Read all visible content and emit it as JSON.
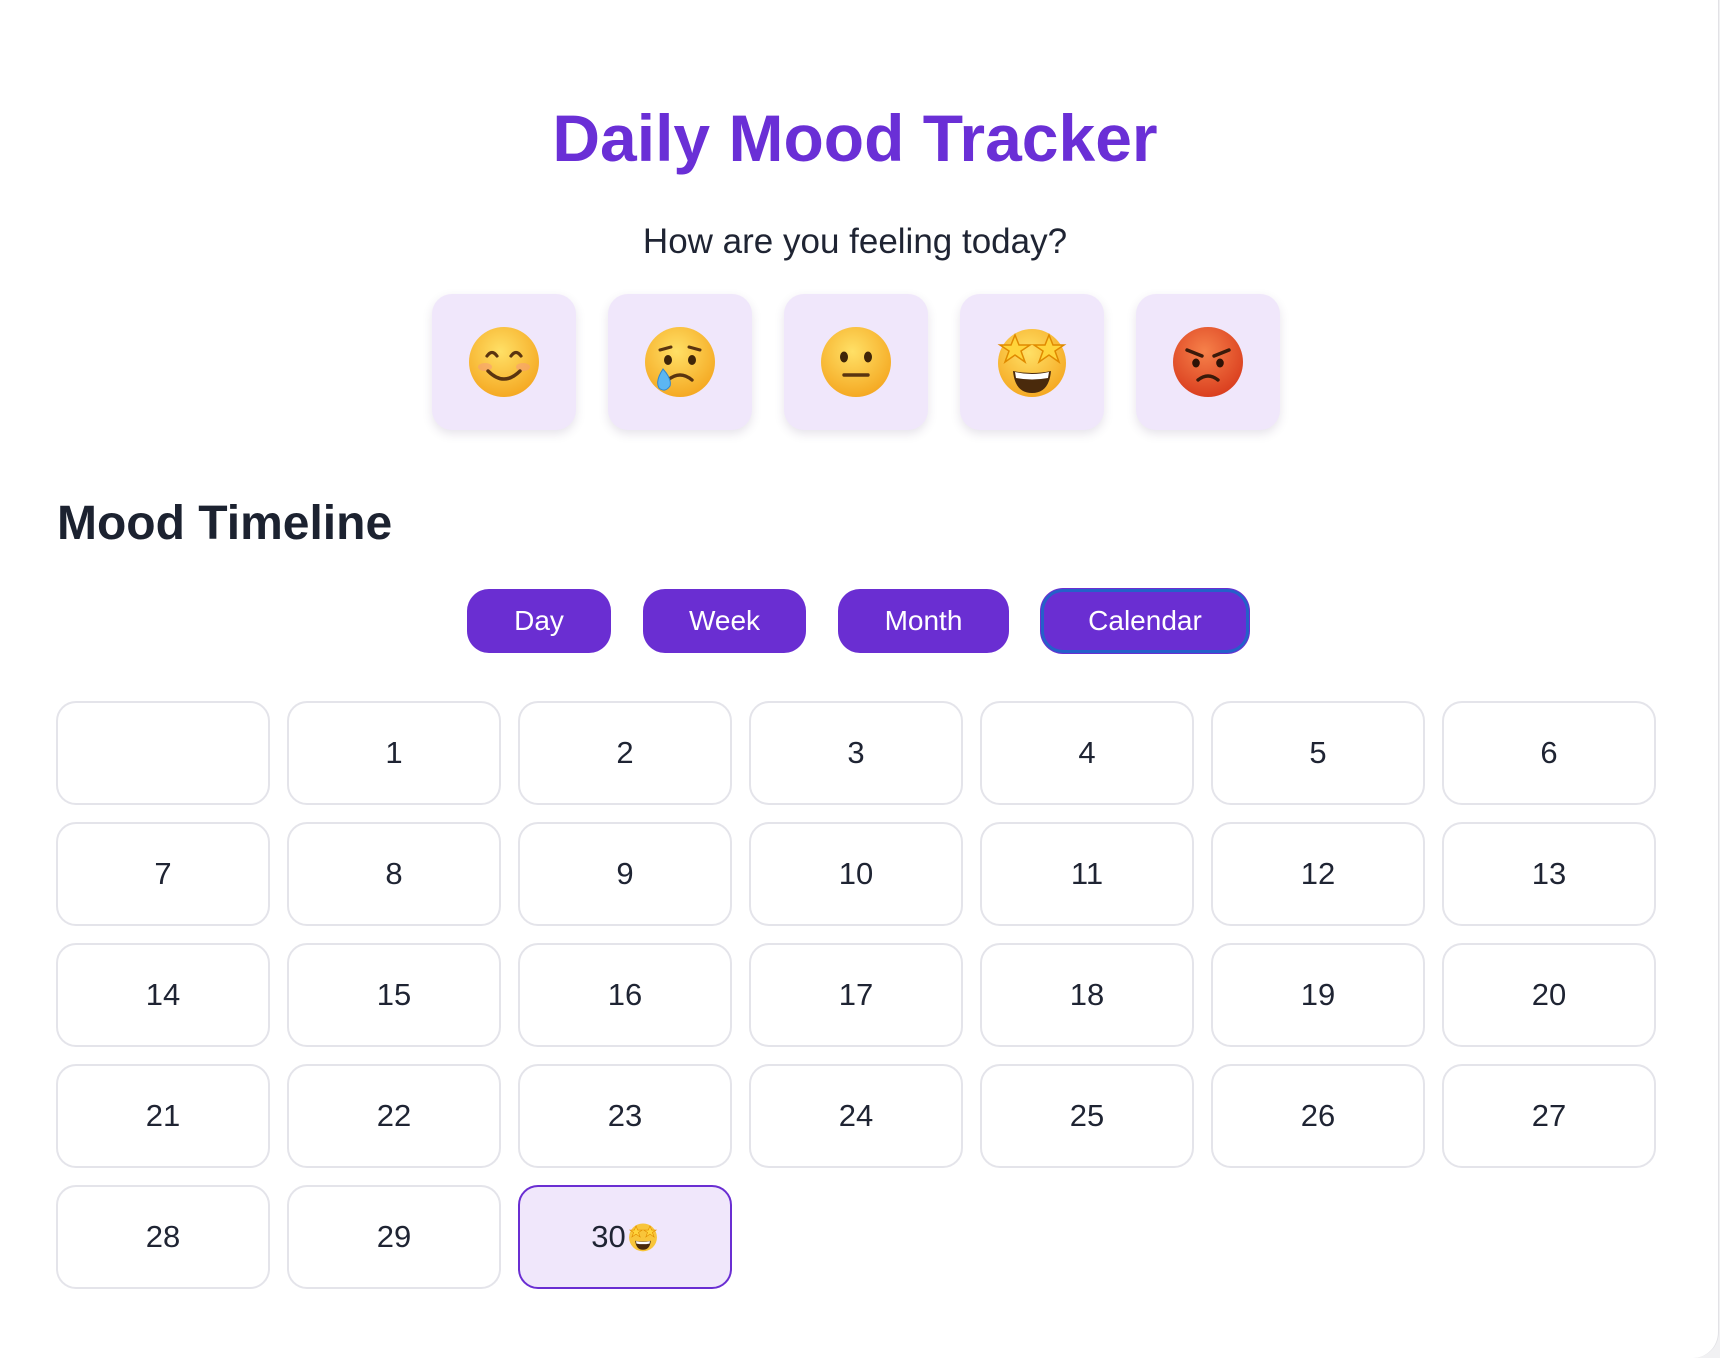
{
  "app": {
    "title": "Daily Mood Tracker",
    "prompt": "How are you feeling today?"
  },
  "moods": [
    {
      "icon": "smiling-face-icon"
    },
    {
      "icon": "crying-face-icon"
    },
    {
      "icon": "neutral-face-icon"
    },
    {
      "icon": "star-struck-face-icon"
    },
    {
      "icon": "angry-face-icon"
    }
  ],
  "timeline": {
    "title": "Mood Timeline",
    "views": [
      {
        "label": "Day"
      },
      {
        "label": "Week"
      },
      {
        "label": "Month"
      },
      {
        "label": "Calendar",
        "active": true
      }
    ]
  },
  "calendar": {
    "leading_blanks": 1,
    "days": [
      "1",
      "2",
      "3",
      "4",
      "5",
      "6",
      "7",
      "8",
      "9",
      "10",
      "11",
      "12",
      "13",
      "14",
      "15",
      "16",
      "17",
      "18",
      "19",
      "20",
      "21",
      "22",
      "23",
      "24",
      "25",
      "26",
      "27",
      "28",
      "29",
      "30"
    ],
    "selected_day": "30",
    "selected_day_mood": "star-struck-face-icon"
  },
  "colors": {
    "accent": "#6a2ed2",
    "title": "#6a2fd6",
    "mood_tile": "#f0e7fb"
  }
}
